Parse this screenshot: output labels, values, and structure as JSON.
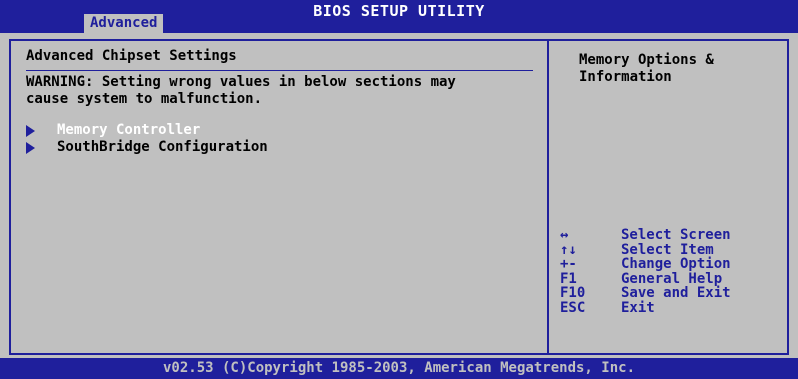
{
  "header": {
    "title": "BIOS SETUP UTILITY",
    "active_tab": "Advanced"
  },
  "main": {
    "heading": "Advanced Chipset Settings",
    "warning_line1": "WARNING: Setting wrong values in below sections may",
    "warning_line2": "cause system to malfunction.",
    "items": [
      {
        "label": "Memory Controller"
      },
      {
        "label": "SouthBridge Configuration"
      }
    ]
  },
  "help": {
    "line1": "Memory Options &",
    "line2": "Information"
  },
  "keys": [
    {
      "key": "↔",
      "action": "Select Screen"
    },
    {
      "key": "↑↓",
      "action": "Select Item"
    },
    {
      "key": "+-",
      "action": "Change Option"
    },
    {
      "key": "F1",
      "action": "General Help"
    },
    {
      "key": "F10",
      "action": "Save and Exit"
    },
    {
      "key": "ESC",
      "action": "Exit"
    }
  ],
  "footer": {
    "text": "v02.53 (C)Copyright 1985-2003, American Megatrends, Inc."
  },
  "colors": {
    "background": "#c0c0c0",
    "accent": "#1f1f9c",
    "selected_text": "#ffffff"
  }
}
